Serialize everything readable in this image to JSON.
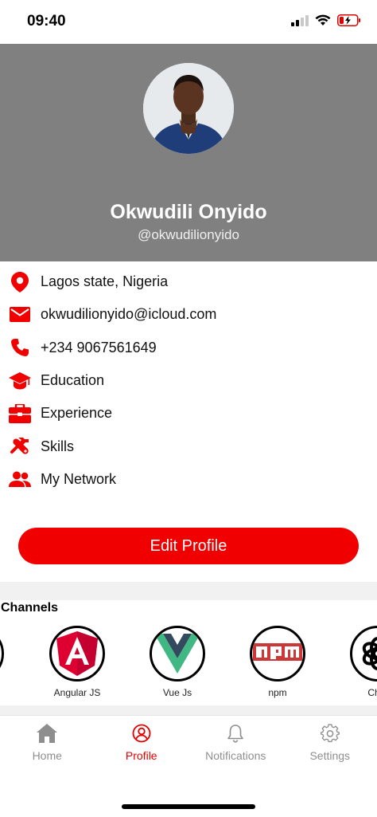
{
  "status_bar": {
    "time": "09:40"
  },
  "profile": {
    "name": "Okwudili Onyido",
    "handle": "@okwudilionyido"
  },
  "info_items": [
    {
      "icon": "location-pin-icon",
      "label": "Lagos state, Nigeria"
    },
    {
      "icon": "mail-icon",
      "label": "okwudilionyido@icloud.com"
    },
    {
      "icon": "phone-icon",
      "label": "+234 9067561649"
    },
    {
      "icon": "graduation-cap-icon",
      "label": "Education"
    },
    {
      "icon": "briefcase-icon",
      "label": "Experience"
    },
    {
      "icon": "tools-icon",
      "label": "Skills"
    },
    {
      "icon": "people-icon",
      "label": "My Network"
    }
  ],
  "edit_button": {
    "label": "Edit Profile"
  },
  "channels": {
    "title": "Channels",
    "items": [
      {
        "label": "Angular JS",
        "icon": "angular-logo-icon"
      },
      {
        "label": "Vue Js",
        "icon": "vue-logo-icon"
      },
      {
        "label": "npm",
        "icon": "npm-logo-icon"
      },
      {
        "label": "Chat",
        "icon": "openai-logo-icon"
      }
    ]
  },
  "tabs": [
    {
      "label": "Home",
      "icon": "home-icon"
    },
    {
      "label": "Profile",
      "icon": "profile-icon",
      "active": true
    },
    {
      "label": "Notifications",
      "icon": "bell-icon"
    },
    {
      "label": "Settings",
      "icon": "gear-icon"
    }
  ],
  "colors": {
    "accent": "#f10000",
    "header_bg": "#808080",
    "inactive_tab": "#8e8e8e"
  }
}
